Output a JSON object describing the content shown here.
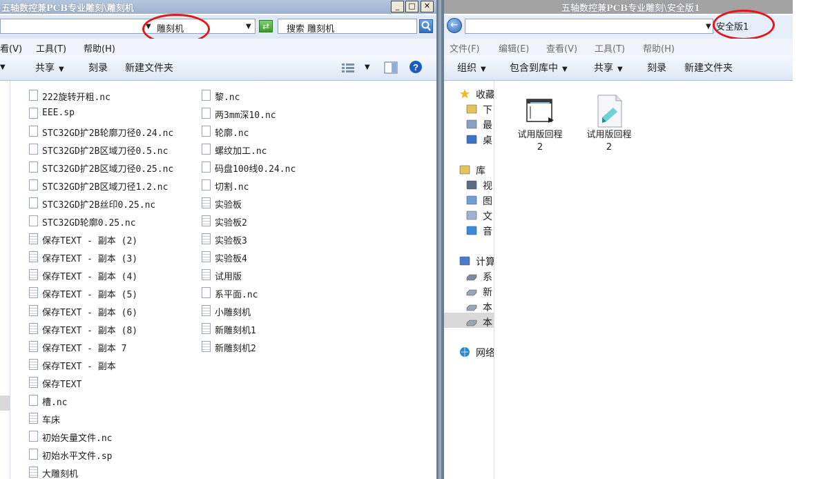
{
  "left_window": {
    "title": "五轴数控兼PCB专业雕刻\\雕刻机",
    "address": "雕刻机",
    "search_placeholder": "搜索 雕刻机",
    "menu": [
      "看(V)",
      "工具(T)",
      "帮助(H)"
    ],
    "toolbar": {
      "share": "共享",
      "burn": "刻录",
      "new_folder": "新建文件夹"
    },
    "files_col1": [
      {
        "name": "222旋转开粗.nc",
        "type": "file"
      },
      {
        "name": "EEE.sp",
        "type": "file"
      },
      {
        "name": "STC32GD扩2B轮廓刀径0.24.nc",
        "type": "file"
      },
      {
        "name": "STC32GD扩2B区域刀径0.5.nc",
        "type": "file"
      },
      {
        "name": "STC32GD扩2B区域刀径0.25.nc",
        "type": "file"
      },
      {
        "name": "STC32GD扩2B区域刀径1.2.nc",
        "type": "file"
      },
      {
        "name": "STC32GD扩2B丝印0.25.nc",
        "type": "file"
      },
      {
        "name": "STC32GD轮廓0.25.nc",
        "type": "file"
      },
      {
        "name": "保存TEXT - 副本 (2)",
        "type": "text"
      },
      {
        "name": "保存TEXT - 副本 (3)",
        "type": "text"
      },
      {
        "name": "保存TEXT - 副本 (4)",
        "type": "text"
      },
      {
        "name": "保存TEXT - 副本 (5)",
        "type": "text"
      },
      {
        "name": "保存TEXT - 副本 (6)",
        "type": "text"
      },
      {
        "name": "保存TEXT - 副本 (8)",
        "type": "text"
      },
      {
        "name": "保存TEXT - 副本 7",
        "type": "text"
      },
      {
        "name": "保存TEXT - 副本",
        "type": "text"
      },
      {
        "name": "保存TEXT",
        "type": "text"
      },
      {
        "name": "槽.nc",
        "type": "file"
      },
      {
        "name": "车床",
        "type": "text"
      },
      {
        "name": "初始矢量文件.nc",
        "type": "file"
      },
      {
        "name": "初始水平文件.sp",
        "type": "file"
      },
      {
        "name": "大雕刻机",
        "type": "text"
      }
    ],
    "files_col2": [
      {
        "name": "黎.nc",
        "type": "file"
      },
      {
        "name": "两3mm深10.nc",
        "type": "file"
      },
      {
        "name": "轮廓.nc",
        "type": "file"
      },
      {
        "name": "螺纹加工.nc",
        "type": "file"
      },
      {
        "name": "码盘100线0.24.nc",
        "type": "file"
      },
      {
        "name": "切割.nc",
        "type": "file"
      },
      {
        "name": "实验板",
        "type": "text"
      },
      {
        "name": "实验板2",
        "type": "text"
      },
      {
        "name": "实验板3",
        "type": "text"
      },
      {
        "name": "实验板4",
        "type": "text"
      },
      {
        "name": "试用版",
        "type": "text"
      },
      {
        "name": "系平面.nc",
        "type": "file"
      },
      {
        "name": "小雕刻机",
        "type": "text"
      },
      {
        "name": "新雕刻机1",
        "type": "text"
      },
      {
        "name": "新雕刻机2",
        "type": "text"
      }
    ]
  },
  "right_window": {
    "title": "五轴数控兼PCB专业雕刻\\安全版1",
    "address": "安全版1",
    "menu": [
      "文件(F)",
      "编辑(E)",
      "查看(V)",
      "工具(T)",
      "帮助(H)"
    ],
    "toolbar": {
      "organize": "组织",
      "include_library": "包含到库中",
      "share": "共享",
      "burn": "刻录",
      "new_folder": "新建文件夹"
    },
    "nav": [
      {
        "label": "收藏",
        "icon": "star-icon"
      },
      {
        "label": "下",
        "icon": "download-folder-icon"
      },
      {
        "label": "最",
        "icon": "recent-places-icon"
      },
      {
        "label": "桌",
        "icon": "desktop-icon"
      },
      {
        "label": "库",
        "icon": "library-icon"
      },
      {
        "label": "视",
        "icon": "video-icon"
      },
      {
        "label": "图",
        "icon": "pictures-icon"
      },
      {
        "label": "文",
        "icon": "documents-icon"
      },
      {
        "label": "音",
        "icon": "music-icon"
      },
      {
        "label": "计算",
        "icon": "computer-icon"
      },
      {
        "label": "系",
        "icon": "system-drive-icon"
      },
      {
        "label": "新",
        "icon": "drive-icon"
      },
      {
        "label": "本",
        "icon": "drive-icon"
      },
      {
        "label": "本",
        "icon": "drive-icon"
      },
      {
        "label": "网络",
        "icon": "network-icon"
      }
    ],
    "items": [
      {
        "name": "试用版回程",
        "line2": "2",
        "icon": "program-icon"
      },
      {
        "name": "试用版回程",
        "line2": "2",
        "icon": "document-icon"
      }
    ]
  },
  "colors": {
    "annotation": "#e0181d",
    "title_bar_active": "#9db2cd",
    "title_bar_inactive": "#a3a3a3"
  }
}
